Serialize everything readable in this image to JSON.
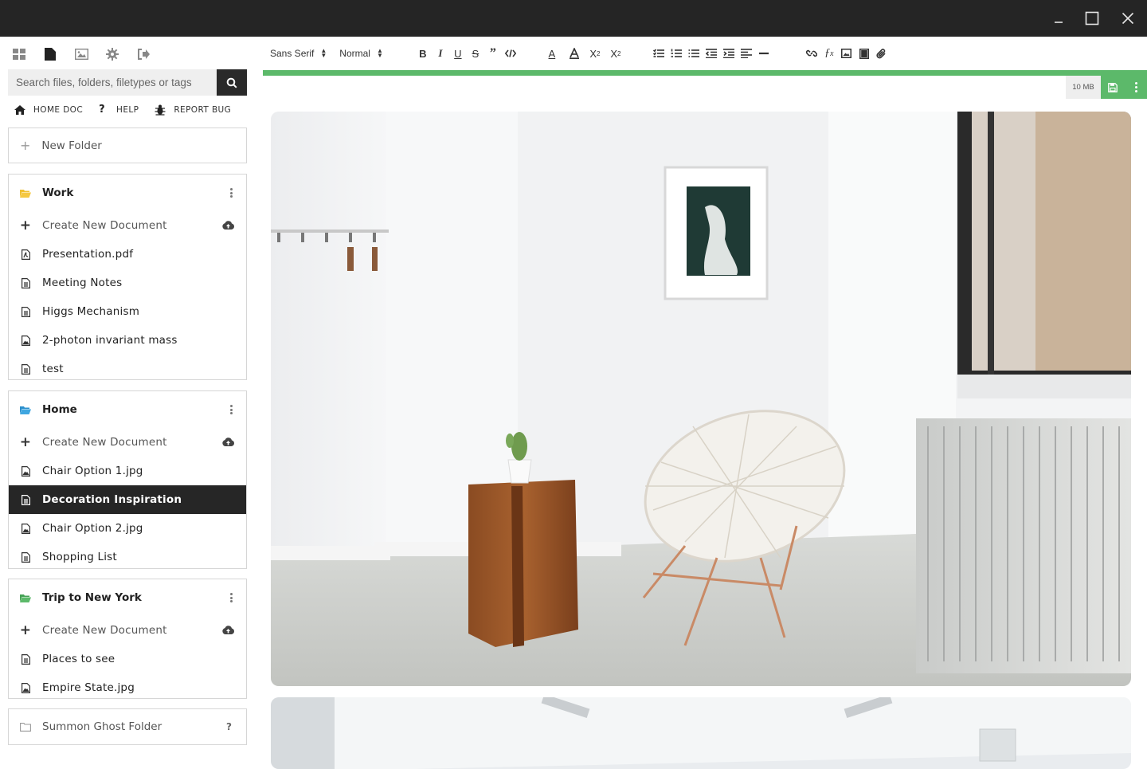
{
  "window": {
    "controls": {
      "minimize": "minimize-icon",
      "maximize": "maximize-icon",
      "close": "close-icon"
    }
  },
  "sidebar": {
    "top_icons": [
      "grid-icon",
      "document-icon",
      "image-icon",
      "gear-icon",
      "logout-icon"
    ],
    "search": {
      "placeholder": "Search files, folders, filetypes or tags",
      "value": ""
    },
    "links": {
      "home": "HOME DOC",
      "help": "HELP",
      "bug": "REPORT BUG"
    },
    "new_folder": "New Folder",
    "folders": [
      {
        "name": "Work",
        "icon_color": "#f5c842",
        "create_label": "Create New Document",
        "items": [
          {
            "label": "Presentation.pdf",
            "icon": "pdf-file-icon"
          },
          {
            "label": "Meeting Notes",
            "icon": "text-document-icon"
          },
          {
            "label": "Higgs Mechanism",
            "icon": "text-document-icon"
          },
          {
            "label": "2-photon invariant mass",
            "icon": "image-file-icon"
          },
          {
            "label": "test",
            "icon": "text-document-icon"
          }
        ]
      },
      {
        "name": "Home",
        "icon_color": "#3fa6e0",
        "create_label": "Create New Document",
        "items": [
          {
            "label": "Chair Option 1.jpg",
            "icon": "image-file-icon"
          },
          {
            "label": "Decoration Inspiration",
            "icon": "text-document-icon",
            "active": true
          },
          {
            "label": "Chair Option 2.jpg",
            "icon": "image-file-icon"
          },
          {
            "label": "Shopping List",
            "icon": "text-document-icon"
          }
        ]
      },
      {
        "name": "Trip to New York",
        "icon_color": "#5cb96a",
        "create_label": "Create New Document",
        "items": [
          {
            "label": "Places to see",
            "icon": "text-document-icon"
          },
          {
            "label": "Empire State.jpg",
            "icon": "image-file-icon"
          }
        ]
      }
    ],
    "ghost_folder": "Summon Ghost Folder",
    "ghost_help": "?"
  },
  "editor": {
    "font_select": "Sans Serif",
    "size_select": "Normal",
    "format_buttons": [
      "bold-icon",
      "italic-icon",
      "underline-icon",
      "strikethrough-icon",
      "blockquote-icon",
      "code-icon"
    ],
    "color_buttons": [
      "text-color-icon",
      "highlight-icon",
      "subscript-icon",
      "superscript-icon"
    ],
    "list_buttons": [
      "checklist-icon",
      "ordered-list-icon",
      "bullet-list-icon",
      "outdent-icon",
      "indent-icon",
      "align-left-icon",
      "horizontal-rule-icon"
    ],
    "insert_buttons": [
      "link-icon",
      "formula-icon",
      "image-icon",
      "video-icon",
      "attachment-icon"
    ],
    "file_size": "10 MB",
    "accent": "#5cb96a"
  }
}
